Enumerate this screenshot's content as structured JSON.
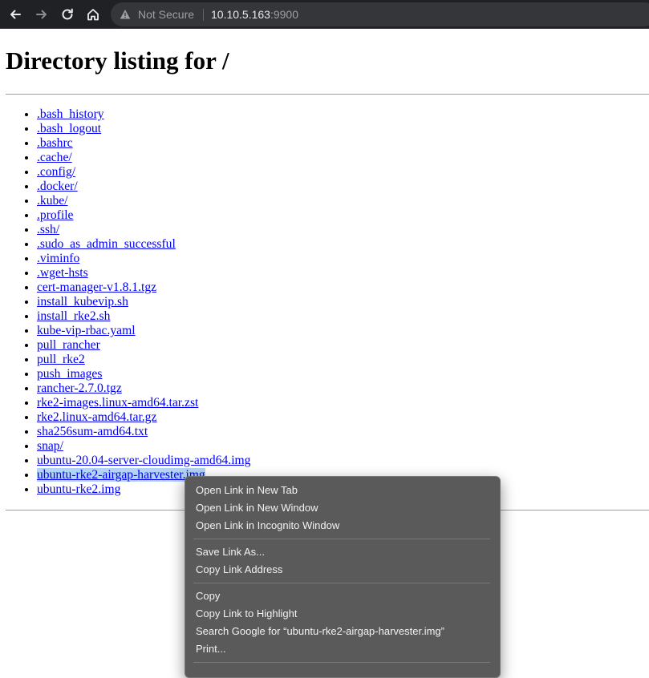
{
  "browser": {
    "security_status": "Not Secure",
    "url_host": "10.10.5.163",
    "url_port": ":9900"
  },
  "page": {
    "title": "Directory listing for /",
    "files": [
      ".bash_history",
      ".bash_logout",
      ".bashrc",
      ".cache/",
      ".config/",
      ".docker/",
      ".kube/",
      ".profile",
      ".ssh/",
      ".sudo_as_admin_successful",
      ".viminfo",
      ".wget-hsts",
      "cert-manager-v1.8.1.tgz",
      "install_kubevip.sh",
      "install_rke2.sh",
      "kube-vip-rbac.yaml",
      "pull_rancher",
      "pull_rke2",
      "push_images",
      "rancher-2.7.0.tgz",
      "rke2-images.linux-amd64.tar.zst",
      "rke2.linux-amd64.tar.gz",
      "sha256sum-amd64.txt",
      "snap/",
      "ubuntu-20.04-server-cloudimg-amd64.img",
      "ubuntu-rke2-airgap-harvester.img",
      "ubuntu-rke2.img"
    ],
    "selected_file": "ubuntu-rke2-airgap-harvester.img"
  },
  "context_menu": {
    "open_new_tab": "Open Link in New Tab",
    "open_new_window": "Open Link in New Window",
    "open_incognito": "Open Link in Incognito Window",
    "save_link_as": "Save Link As...",
    "copy_link_address": "Copy Link Address",
    "copy": "Copy",
    "copy_link_to_highlight": "Copy Link to Highlight",
    "search_google": "Search Google for “ubuntu-rke2-airgap-harvester.img”",
    "print": "Print..."
  },
  "colors": {
    "link": "#0000ee",
    "selection": "#b3d3f7",
    "menu_bg": "#5a5a5a",
    "toolbar_bg": "#202124"
  }
}
